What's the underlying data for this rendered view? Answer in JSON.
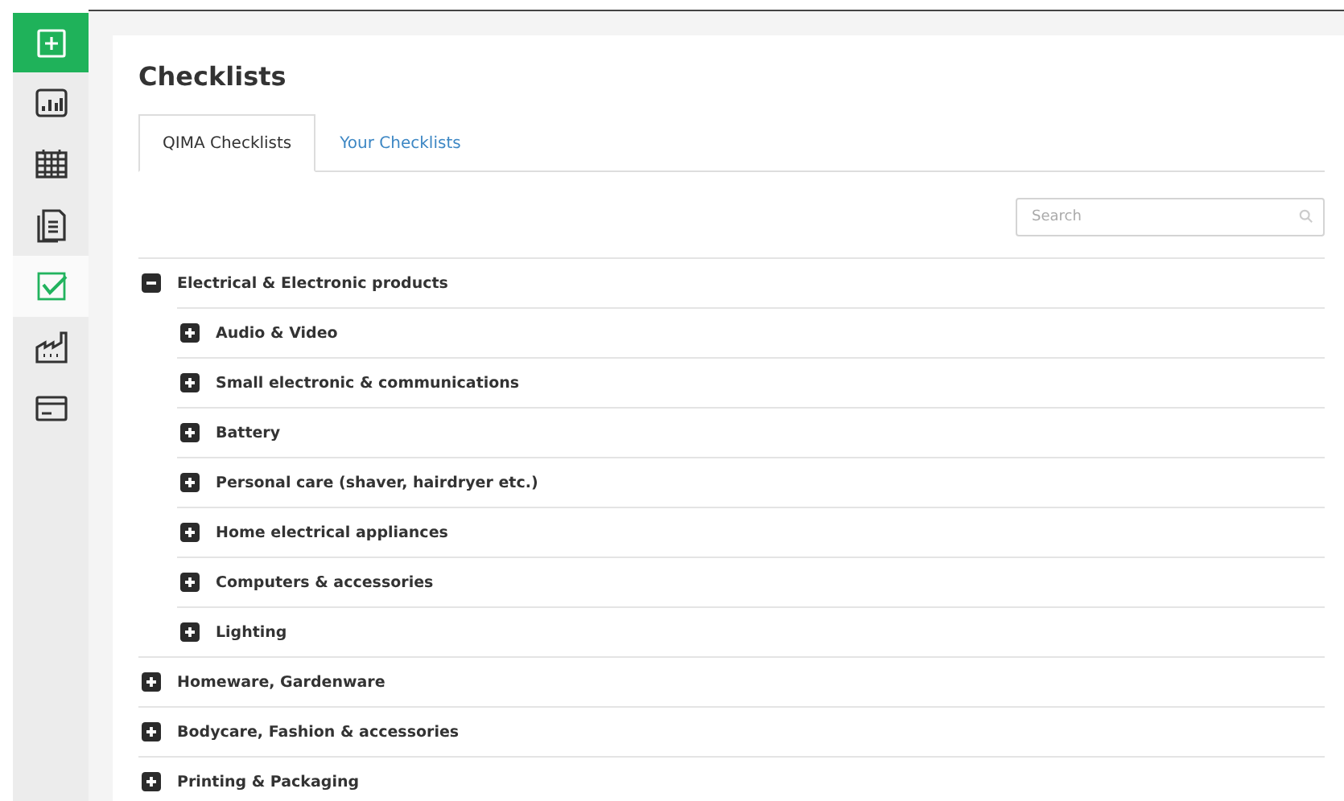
{
  "sidebar": {
    "items": [
      {
        "kind": "add",
        "selected": false
      },
      {
        "kind": "chart",
        "selected": false
      },
      {
        "kind": "calendar",
        "selected": false
      },
      {
        "kind": "documents",
        "selected": false
      },
      {
        "kind": "checklist",
        "selected": true
      },
      {
        "kind": "factory",
        "selected": false
      },
      {
        "kind": "card",
        "selected": false
      }
    ]
  },
  "page": {
    "title": "Checklists"
  },
  "tabs": [
    {
      "label": "QIMA Checklists",
      "selected": true
    },
    {
      "label": "Your Checklists",
      "selected": false
    }
  ],
  "search": {
    "placeholder": "Search"
  },
  "tree": [
    {
      "label": "Electrical & Electronic products",
      "expanded": true,
      "children": [
        {
          "label": "Audio & Video",
          "expanded": false
        },
        {
          "label": "Small electronic & communications",
          "expanded": false
        },
        {
          "label": "Battery",
          "expanded": false
        },
        {
          "label": "Personal care (shaver, hairdryer etc.)",
          "expanded": false
        },
        {
          "label": "Home electrical appliances",
          "expanded": false
        },
        {
          "label": "Computers & accessories",
          "expanded": false
        },
        {
          "label": "Lighting",
          "expanded": false
        }
      ]
    },
    {
      "label": "Homeware, Gardenware",
      "expanded": false
    },
    {
      "label": "Bodycare, Fashion & accessories",
      "expanded": false
    },
    {
      "label": "Printing & Packaging",
      "expanded": false
    }
  ]
}
